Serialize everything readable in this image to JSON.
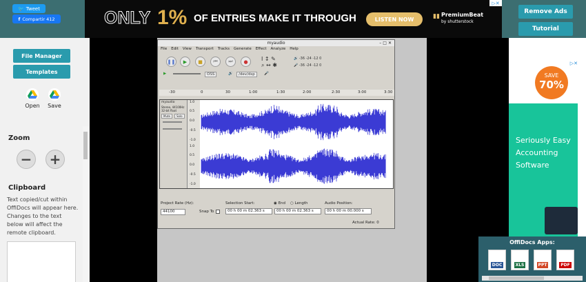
{
  "topbar": {
    "tweet_label": "Tweet",
    "share_label": "Compartir 412",
    "remove_ads_label": "Remove Ads",
    "tutorial_label": "Tutorial"
  },
  "ad": {
    "only": "ONLY",
    "percent": "1%",
    "text": "OF ENTRIES MAKE IT THROUGH",
    "cta": "LISTEN NOW",
    "brand": "PremiumBeat",
    "brand_sub": "by shutterstock"
  },
  "leftpanel": {
    "file_manager_label": "File Manager",
    "templates_label": "Templates",
    "open_label": "Open",
    "save_label": "Save",
    "zoom_heading": "Zoom",
    "zoom_out": "−",
    "zoom_in": "+",
    "clipboard_heading": "Clipboard",
    "clipboard_text": "Text copied/cut within OffiDocs will appear here. Changes to the text below will affect the remote clipboard."
  },
  "audacity": {
    "title": "myaudio",
    "menu": [
      "File",
      "Edit",
      "View",
      "Transport",
      "Tracks",
      "Generate",
      "Effect",
      "Analyze",
      "Help"
    ],
    "meter_left": "-36 -24 -12 0",
    "meter_right": "-36 -24 -12 0",
    "host": "OSS",
    "device": "/dev/dsp",
    "timeline_labels": [
      "-30",
      "0",
      "30",
      "1:00",
      "1:30",
      "2:00",
      "2:30",
      "3:00",
      "3:30"
    ],
    "track_name": "myaudio",
    "track_info": "Stereo, 44100Hz",
    "track_format": "32-bit float",
    "mute_label": "Mute",
    "solo_label": "Solo",
    "ruler": [
      "1.0",
      "0.5",
      "0.0",
      "-0.5",
      "-1.0"
    ],
    "project_rate_label": "Project Rate (Hz):",
    "project_rate_value": "44100",
    "snap_to_label": "Snap To",
    "selection_start_label": "Selection Start:",
    "end_label": "End",
    "length_label": "Length",
    "audio_position_label": "Audio Position:",
    "selection_start_value": "00 h 00 m 02.363 s",
    "selection_end_value": "00 h 00 m 02.363 s",
    "audio_position_value": "00 h 00 m 00.000 s",
    "actual_rate": "Actual Rate: 0"
  },
  "rightad": {
    "save_label": "SAVE",
    "save_pct": "70%",
    "text": "Seriously Easy Accounting Software"
  },
  "apps": {
    "title": "OffiDocs Apps:",
    "items": [
      "DOC",
      "XLS",
      "PPT",
      "PDF"
    ]
  },
  "colors": {
    "teal": "#2a9bad",
    "header": "#3c6e71",
    "waveform": "#3b3bd4",
    "ad_gold": "#e0b04e"
  }
}
